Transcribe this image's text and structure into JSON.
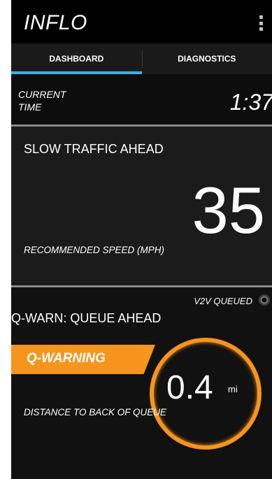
{
  "app": {
    "title": "INFLO"
  },
  "tabs": [
    {
      "label": "DASHBOARD",
      "active": true
    },
    {
      "label": "DIAGNOSTICS",
      "active": false
    }
  ],
  "current_time": {
    "label": "CURRENT TIME",
    "value": "1:37"
  },
  "traffic": {
    "title": "SLOW TRAFFIC AHEAD",
    "speed_value": "35",
    "speed_label": "RECOMMENDED SPEED (MPH)"
  },
  "queue": {
    "v2v_label": "V2V QUEUED",
    "title": "Q-WARN: QUEUE AHEAD",
    "banner": "Q-WARNING",
    "distance_value": "0.4",
    "distance_unit": "mi",
    "distance_label": "DISTANCE TO BACK OF QUEUE"
  },
  "colors": {
    "accent": "#33b5e5",
    "warning": "#f7941d"
  }
}
